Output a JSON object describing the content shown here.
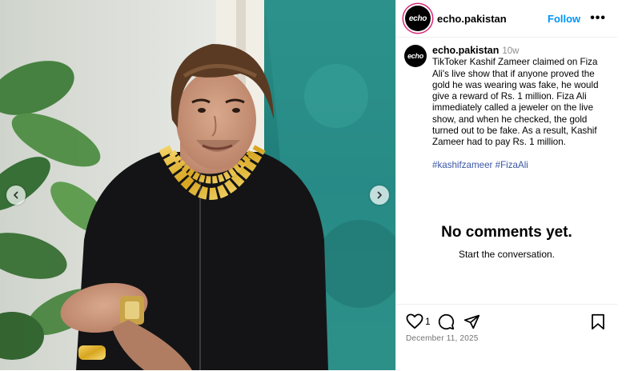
{
  "post": {
    "username": "echo.pakistan",
    "avatar_text": "echo",
    "follow_label": "Follow",
    "more_label": "•••",
    "time_ago": "10w",
    "caption": "TikToker Kashif Zameer claimed on Fiza Ali's live show that if anyone proved the gold he was wearing was fake, he would give a reward of Rs. 1 million. Fiza Ali immediately called a jeweler on the live show, and when he checked, the gold turned out to be fake. As a result, Kashif Zameer had to pay Rs. 1 million.",
    "hashtags": [
      "#kashifzameer",
      "#FizaAli"
    ],
    "likes": "1",
    "date": "December 11, 2025"
  },
  "comments": {
    "empty_title": "No comments yet.",
    "empty_subtitle": "Start the conversation."
  },
  "icons": {
    "prev": "chevron-left-icon",
    "next": "chevron-right-icon",
    "like": "heart-icon",
    "comment": "comment-icon",
    "share": "send-icon",
    "save": "bookmark-icon"
  },
  "colors": {
    "accent": "#0095f6",
    "hashtag": "#3b56a6",
    "muted": "#737373"
  }
}
